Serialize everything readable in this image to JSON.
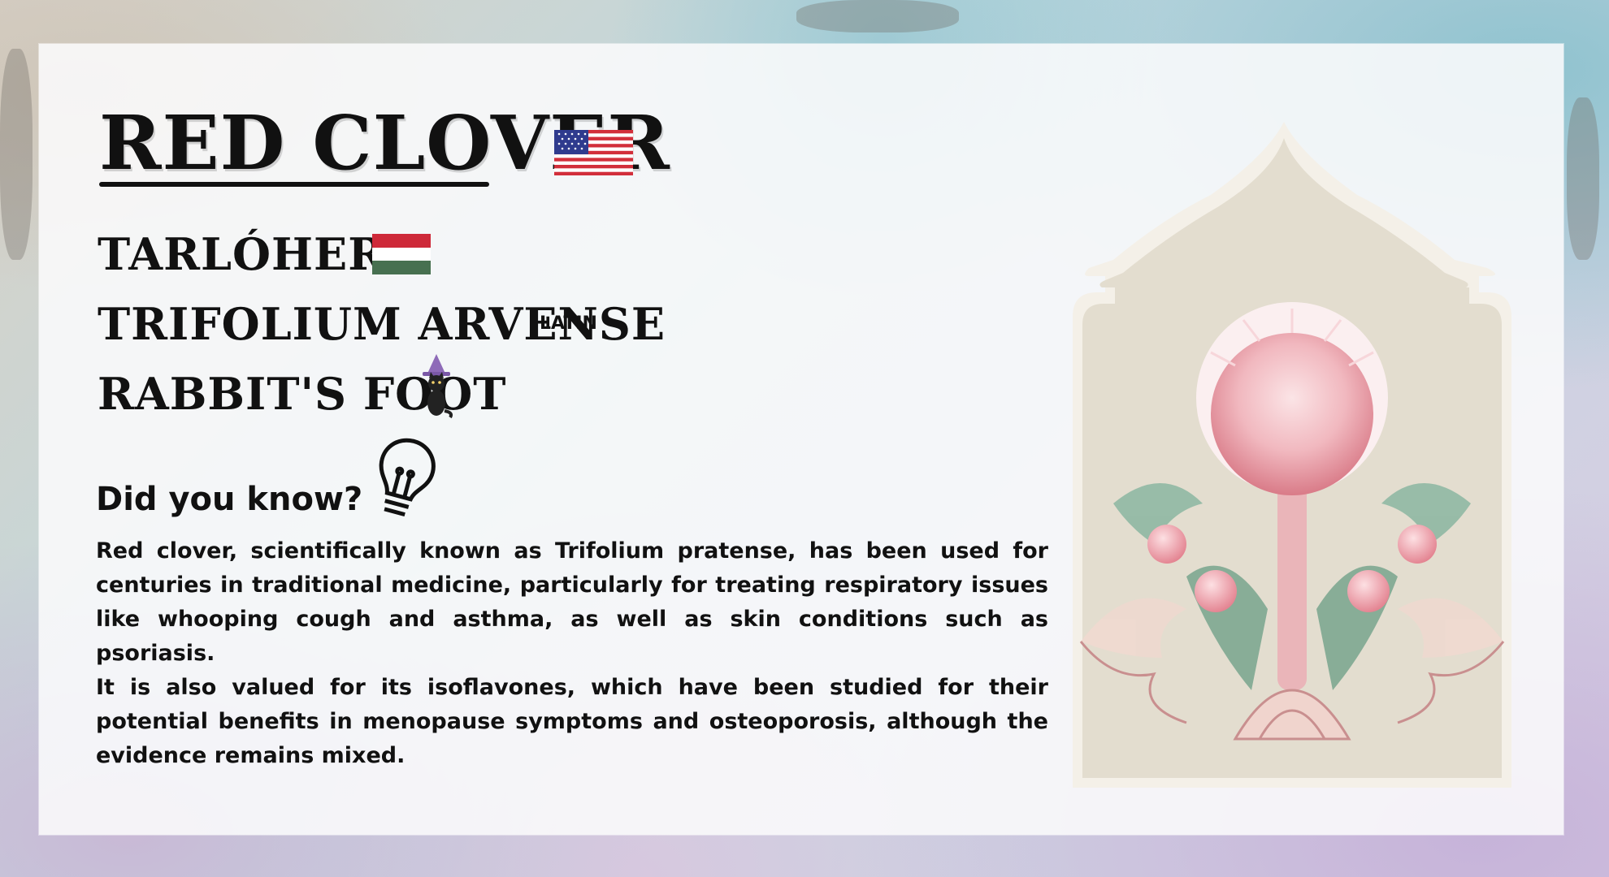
{
  "card": {
    "title": "RED CLOVER",
    "names": [
      {
        "text": "TARLÓHERE"
      },
      {
        "text": "TRIFOLIUM ARVENSE",
        "tag": "LATIN"
      },
      {
        "text": "RABBIT'S FOOT"
      }
    ],
    "did_you_know": {
      "heading": "Did you know?",
      "paragraphs": [
        "Red clover, scientifically known as Trifolium pratense, has been used for centuries in traditional medicine, particularly for treating respiratory issues like whooping cough and asthma, as well as skin conditions such as psoriasis.",
        "It is also valued for its isoflavones, which have been studied for their potential benefits in menopause symptoms and osteoporosis, although the evidence remains mixed."
      ]
    }
  },
  "icons": {
    "us_flag": "flag-us-icon",
    "hu_flag": "flag-hu-icon",
    "witch_cat": "witch-cat-icon",
    "lightbulb": "lightbulb-icon"
  },
  "colors": {
    "text": "#111111",
    "flag_red": "#ce2939",
    "flag_green": "#477050",
    "arch_bg": "#e3ddcf",
    "flower_pink": "#e8a3ad",
    "leaf_green": "#8fb8a3"
  }
}
